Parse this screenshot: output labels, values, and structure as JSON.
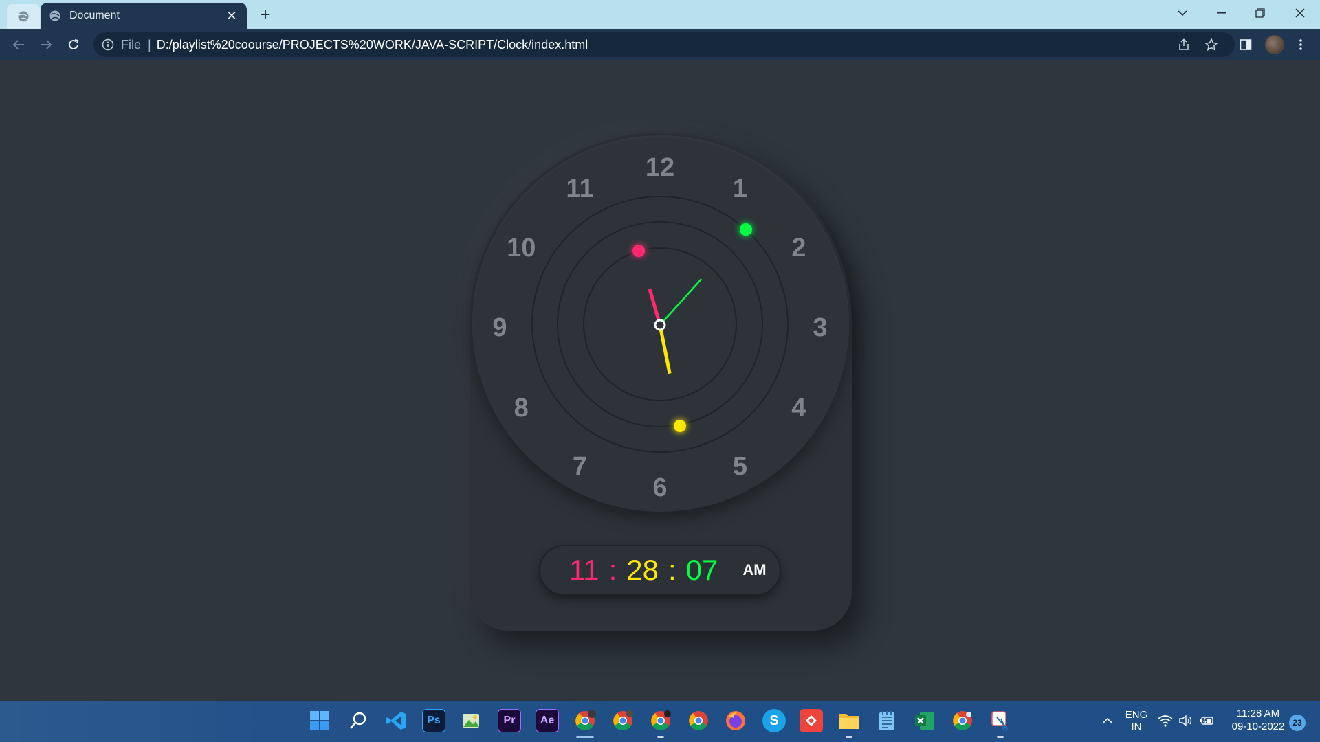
{
  "browser": {
    "tab_title": "Document",
    "address_scheme": "File",
    "address_url": "D:/playlist%20coourse/PROJECTS%20WORK/JAVA-SCRIPT/Clock/index.html"
  },
  "clock": {
    "numbers": [
      "12",
      "1",
      "2",
      "3",
      "4",
      "5",
      "6",
      "7",
      "8",
      "9",
      "10",
      "11"
    ],
    "time": {
      "hours": "11",
      "minutes": "28",
      "seconds": "07",
      "separator": ":",
      "period": "AM"
    },
    "hand_values": {
      "hours": 11,
      "minutes": 28,
      "seconds": 7
    },
    "colors": {
      "hour": "#ff2972",
      "minute": "#fee800",
      "second": "#04fc43"
    }
  },
  "taskbar": {
    "apps": [
      {
        "name": "windows-start-icon"
      },
      {
        "name": "search-icon"
      },
      {
        "name": "vscode-icon"
      },
      {
        "name": "photoshop-icon",
        "label": "Ps"
      },
      {
        "name": "image-viewer-icon"
      },
      {
        "name": "premiere-pro-icon",
        "label": "Pr"
      },
      {
        "name": "after-effects-icon",
        "label": "Ae"
      },
      {
        "name": "chrome-profile-1-icon"
      },
      {
        "name": "chrome-profile-2-icon"
      },
      {
        "name": "chrome-profile-3-icon"
      },
      {
        "name": "chrome-icon"
      },
      {
        "name": "firefox-icon"
      },
      {
        "name": "skype-icon",
        "label": "S"
      },
      {
        "name": "anydesk-icon"
      },
      {
        "name": "file-explorer-icon"
      },
      {
        "name": "notepad-icon"
      },
      {
        "name": "excel-icon"
      },
      {
        "name": "chrome-profile-4-icon"
      },
      {
        "name": "snipping-tool-icon"
      }
    ],
    "tray": {
      "language_top": "ENG",
      "language_bottom": "IN",
      "time": "11:28 AM",
      "date": "09-10-2022",
      "notification_count": "23"
    }
  }
}
